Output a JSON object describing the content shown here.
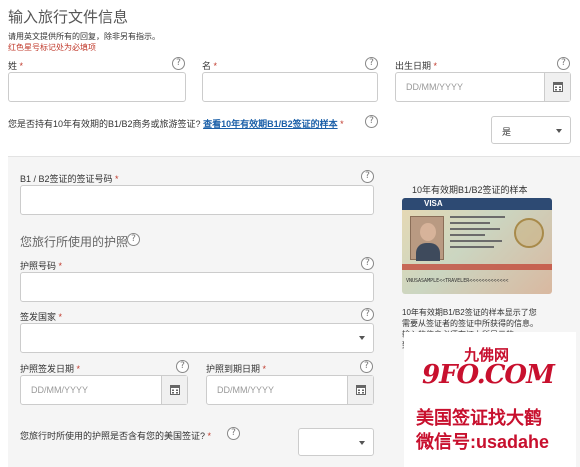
{
  "header": {
    "title": "输入旅行文件信息",
    "instructions": "请用英文提供所有的回复，除非另有指示。",
    "required_note": "红色星号标记处为必填项"
  },
  "name_row": {
    "surname_label": "姓",
    "given_name_label": "名",
    "dob_label": "出生日期",
    "dob_placeholder": "DD/MM/YYYY",
    "required_mark": "*"
  },
  "visa_question": {
    "text": "您是否持有10年有效期的B1/B2商务或旅游签证?",
    "link": "查看10年有效期B1/B2签证的样本",
    "selected": "是"
  },
  "visa_number": {
    "label": "B1 / B2签证的签证号码"
  },
  "passport_section": {
    "heading": "您旅行所使用的护照",
    "passport_number_label": "护照号码",
    "issuing_country_label": "签发国家",
    "issue_date_label": "护照签发日期",
    "expiry_date_label": "护照到期日期",
    "date_placeholder": "DD/MM/YYYY",
    "contains_visa_question": "您旅行时所使用的护照是否含有您的美国签证?"
  },
  "sample": {
    "title": "10年有效期B1/B2签证的样本",
    "description_1": "10年有效期B1/B2签证的样本显示了您",
    "description_2": "需要从签证者的签证中所获得的信息。",
    "description_3": "输入的信息必须在证上所显示的一",
    "description_4": "致",
    "visa_text": "VISA",
    "mrz": "VNUSASAMPLE<<TRAVELER<<<<<<<<<<<<<"
  },
  "watermark": {
    "site_cn": "九佛网",
    "site_en": "9FO.COM",
    "line1": "美国签证找大鹤",
    "line2": "微信号:usadahe"
  },
  "colors": {
    "required": "#c0392b",
    "link": "#1a5fa8",
    "watermark_red": "#c8102e",
    "panel_bg": "#f5f5f5"
  }
}
